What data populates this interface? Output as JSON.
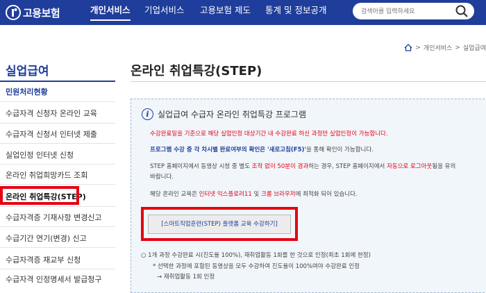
{
  "header": {
    "logo_text": "고용보험",
    "nav": [
      "개인서비스",
      "기업서비스",
      "고용보험 제도",
      "통계 및 정보공개"
    ],
    "search_placeholder": "검색어를 입력하세요"
  },
  "breadcrumb": [
    "개인서비스",
    "실업급여"
  ],
  "sidebar": {
    "title": "실업급여",
    "items": [
      "민원처리현황",
      "수급자격 신청자 온라인 교육",
      "수급자격 신청서 인터넷 제출",
      "실업인정 인터넷 신청",
      "온라인 취업희망카드 조회",
      "온라인 취업특강(STEP)",
      "수급자격증 기재사항 변경신고",
      "수급기간 연기(변경) 신고",
      "수급자격증 재교부 신청",
      "수급자격 인정명세서 발급청구"
    ]
  },
  "main": {
    "page_title": "온라인 취업특강(STEP)",
    "panel_heading": "실업급여 수급자 온라인 취업특강 프로그램",
    "line1": "수강완료일을 기준으로 해당 실업인정 대상기간 내 수강완료 하신 과정만 실업인정이 가능합니다.",
    "line2_a": "프로그램 수강 중 각 차시별",
    "line2_b": "완료여부의 확인은 '새로고침(F5)'",
    "line2_c": "을 통해 확인이 가능합니다.",
    "line3_a": "STEP 홈페이지에서 동영상 시청 중 별도",
    "line3_b": "조작 없이 50분이 경과",
    "line3_c": "하는 경우, STEP 홈페이지에서",
    "line3_d": "자동으로 로그아웃",
    "line3_e": "됨을 유의",
    "line3_f": "바랍니다.",
    "line4_a": "해당 온라인 교육은",
    "line4_b": "인터넷 익스플로러11",
    "line4_c": "및",
    "line4_d": "크롬 브라우저",
    "line4_e": "에 최적화 되어 있습니다.",
    "button_label": "[스마트직업훈련(STEP) 플랫폼 교육 수강하기]",
    "note1": "○ 1개 과정 수강완료 시(진도율 100%), 재취업활동 1회를 한 것으로 인정(최초 1회에 한정)",
    "note2": "* 선택한 과정에 포함된 동영상을 모두 수강하여 진도율이 100%여야 수강완료 인정",
    "note3": "→ 재취업활동 1회 인정"
  }
}
